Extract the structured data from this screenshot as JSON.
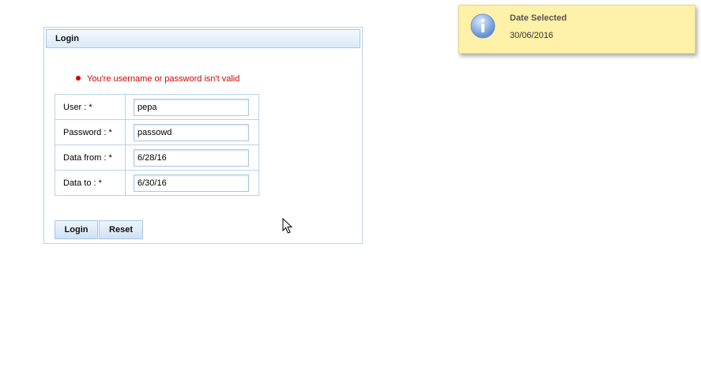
{
  "login_panel": {
    "title": "Login",
    "error_message": "You're username or password isn't valid",
    "fields": [
      {
        "label": "User :   *",
        "value": "pepa"
      },
      {
        "label": "Password :  *",
        "value": "passowd"
      },
      {
        "label": "Data from :  *",
        "value": "6/28/16"
      },
      {
        "label": "Data to :  *",
        "value": "6/30/16"
      }
    ],
    "buttons": {
      "login_label": "Login",
      "reset_label": "Reset"
    }
  },
  "notification": {
    "icon": "info-icon",
    "title": "Date Selected",
    "text": "30/06/2016"
  },
  "colors": {
    "error": "#d40000",
    "notification_bg": "#fff1a8",
    "border": "#b9d3e8"
  }
}
